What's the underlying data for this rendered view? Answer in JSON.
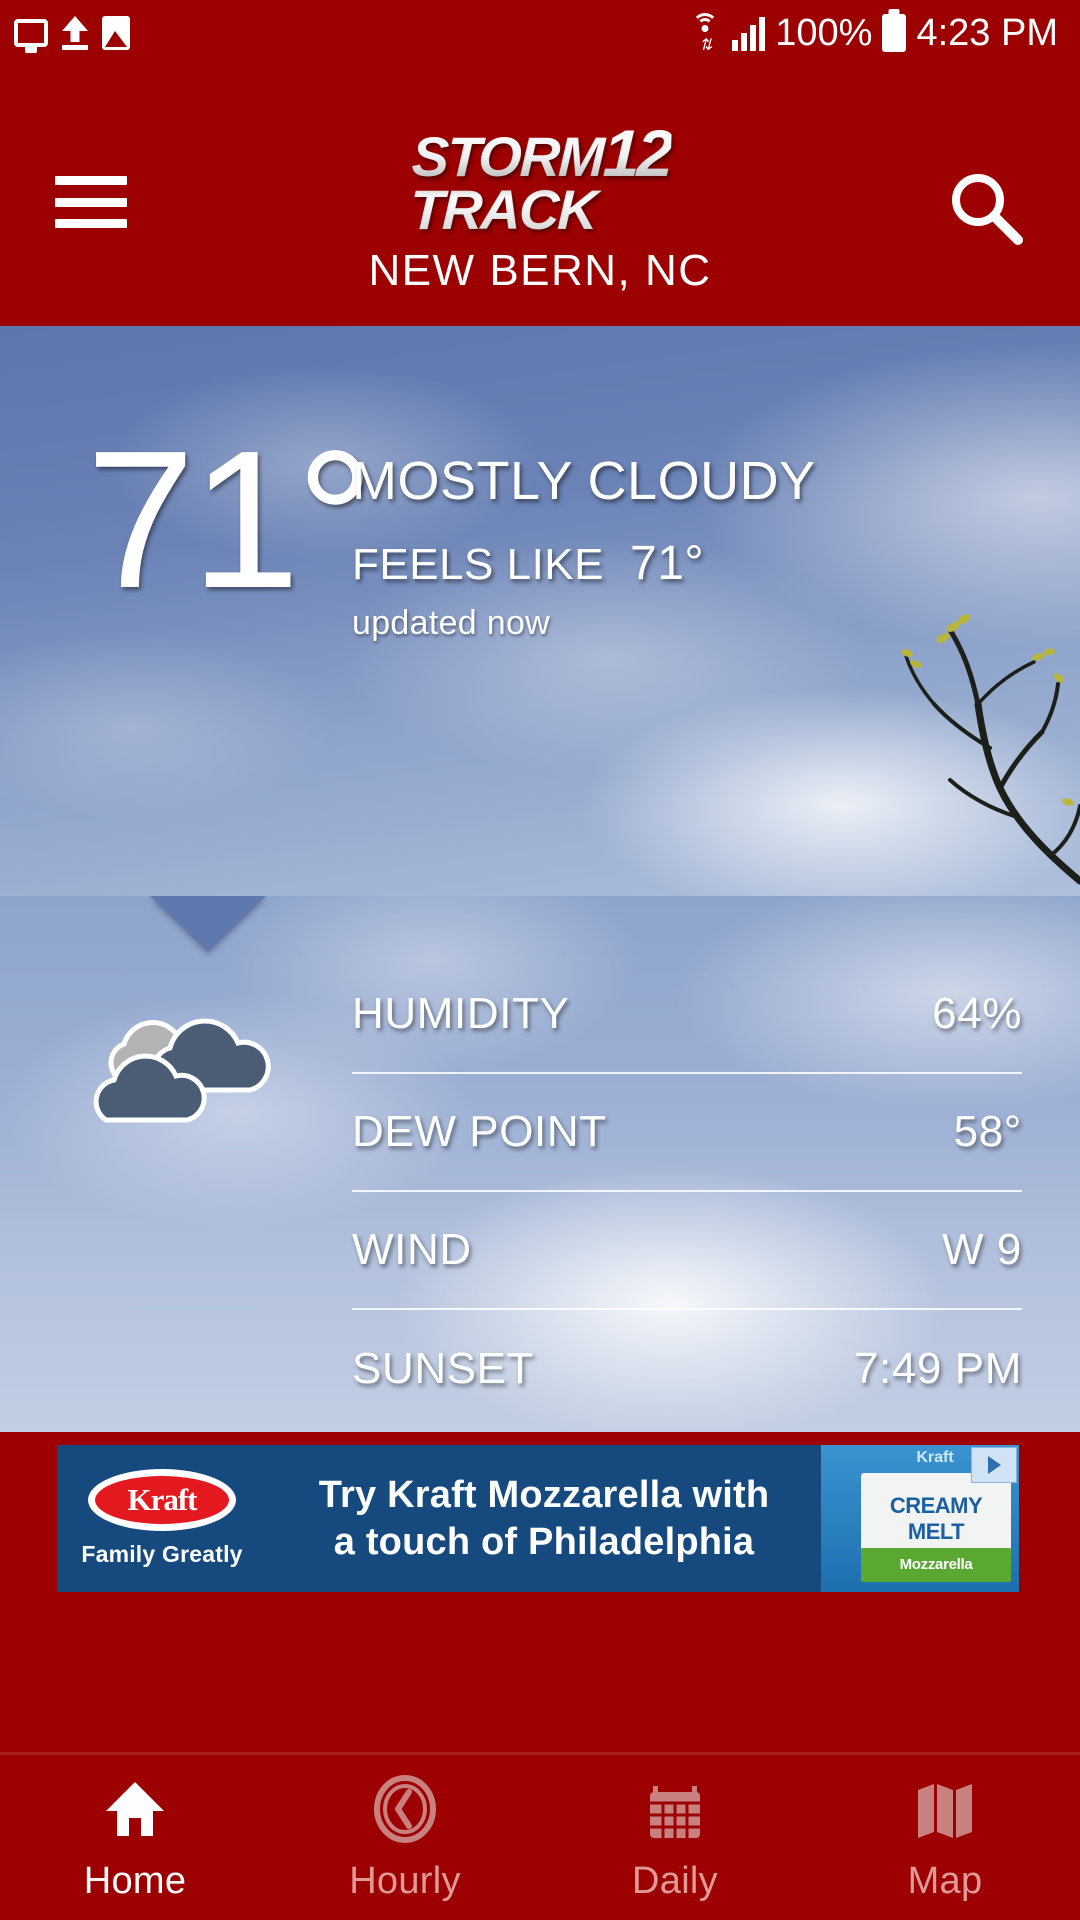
{
  "status_bar": {
    "time": "4:23 PM",
    "battery_percent": "100%",
    "icons": [
      "cast-icon",
      "upload-icon",
      "image-icon",
      "wifi-icon",
      "cellular-signal-icon",
      "battery-icon"
    ]
  },
  "header": {
    "menu_icon": "hamburger-menu-icon",
    "search_icon": "search-icon",
    "brand_line1": "STORM",
    "brand_line2": "TRACK",
    "brand_number": "12",
    "location": "NEW BERN, NC",
    "background_color": "#9d0001"
  },
  "current": {
    "temperature": "71°",
    "condition": "MOSTLY CLOUDY",
    "feels_like_label": "FEELS LIKE",
    "feels_like_value": "71°",
    "updated": "updated now",
    "icon": "mostly-cloudy-icon"
  },
  "details": {
    "rows": [
      {
        "label": "HUMIDITY",
        "value": "64%"
      },
      {
        "label": "DEW POINT",
        "value": "58°"
      },
      {
        "label": "WIND",
        "value": "W 9"
      },
      {
        "label": "SUNSET",
        "value": "7:49 PM"
      }
    ]
  },
  "ad": {
    "brand": "Kraft",
    "tagline": "Family Greatly",
    "headline_line1": "Try Kraft Mozzarella with",
    "headline_line2": "a touch of Philadelphia",
    "product_top": "Kraft",
    "product_name": "CREAMY MELT",
    "product_sub": "Mozzarella",
    "background_color": "#164a7e",
    "choices_icon": "ad-choices-icon"
  },
  "bottom_nav": {
    "items": [
      {
        "label": "Home",
        "icon": "home-icon",
        "active": true
      },
      {
        "label": "Hourly",
        "icon": "clock-icon",
        "active": false
      },
      {
        "label": "Daily",
        "icon": "calendar-icon",
        "active": false
      },
      {
        "label": "Map",
        "icon": "map-icon",
        "active": false
      }
    ]
  }
}
